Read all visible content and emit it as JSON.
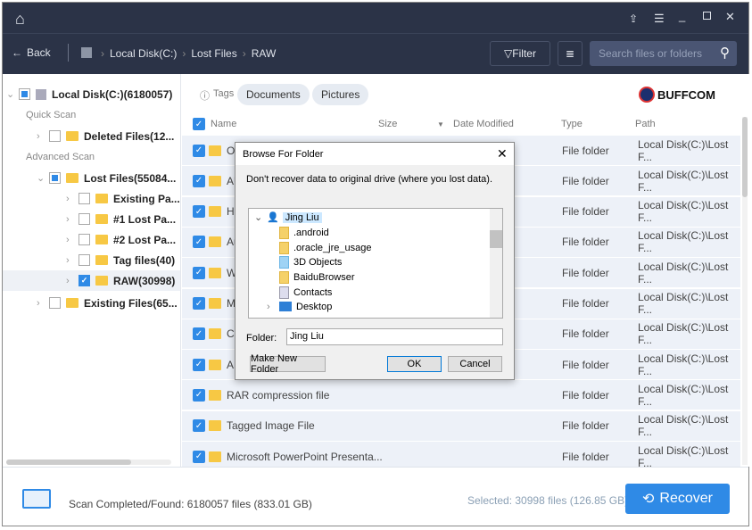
{
  "titlebar": {
    "icons": [
      "home-icon",
      "share-icon",
      "menu-icon",
      "minimize-icon",
      "maximize-icon",
      "close-icon"
    ]
  },
  "toolbar": {
    "back": "Back",
    "breadcrumb": [
      "Local Disk(C:)",
      "Lost Files",
      "RAW"
    ],
    "filter": "Filter",
    "search_placeholder": "Search files or folders"
  },
  "sidebar": {
    "root": "Local Disk(C:)(6180057)",
    "quick_scan": "Quick Scan",
    "deleted": "Deleted Files(12...",
    "advanced_scan": "Advanced Scan",
    "lost": "Lost Files(55084...",
    "children": [
      "Existing Pa...",
      "#1 Lost Pa...",
      "#2 Lost Pa...",
      "Tag files(40)",
      "RAW(30998)"
    ],
    "existing": "Existing Files(65..."
  },
  "tags": {
    "label": "Tags",
    "items": [
      "Documents",
      "Pictures"
    ]
  },
  "logo": "BUFFCOM",
  "columns": {
    "name": "Name",
    "size": "Size",
    "date": "Date Modified",
    "type": "Type",
    "path": "Path"
  },
  "rows": [
    {
      "name": "Og",
      "type": "File folder",
      "path": "Local Disk(C:)\\Lost F..."
    },
    {
      "name": "AU",
      "type": "File folder",
      "path": "Local Disk(C:)\\Lost F..."
    },
    {
      "name": "He",
      "type": "File folder",
      "path": "Local Disk(C:)\\Lost F..."
    },
    {
      "name": "Au",
      "type": "File folder",
      "path": "Local Disk(C:)\\Lost F..."
    },
    {
      "name": "W",
      "type": "File folder",
      "path": "Local Disk(C:)\\Lost F..."
    },
    {
      "name": "M",
      "type": "File folder",
      "path": "Local Disk(C:)\\Lost F..."
    },
    {
      "name": "Ch",
      "type": "File folder",
      "path": "Local Disk(C:)\\Lost F..."
    },
    {
      "name": "AN",
      "type": "File folder",
      "path": "Local Disk(C:)\\Lost F..."
    },
    {
      "name": "RAR compression file",
      "type": "File folder",
      "path": "Local Disk(C:)\\Lost F..."
    },
    {
      "name": "Tagged Image File",
      "type": "File folder",
      "path": "Local Disk(C:)\\Lost F..."
    },
    {
      "name": "Microsoft PowerPoint Presenta...",
      "type": "File folder",
      "path": "Local Disk(C:)\\Lost F..."
    }
  ],
  "footer": {
    "status": "Scan Completed/Found: 6180057 files (833.01 GB)",
    "selected": "Selected: 30998 files (126.85 GB)",
    "recover": "Recover"
  },
  "dialog": {
    "title": "Browse For Folder",
    "message": "Don't recover data to original drive (where you lost data).",
    "tree": [
      "Jing Liu",
      ".android",
      ".oracle_jre_usage",
      "3D Objects",
      "BaiduBrowser",
      "Contacts",
      "Desktop"
    ],
    "folder_label": "Folder:",
    "folder_value": "Jing Liu",
    "make_new": "Make New Folder",
    "ok": "OK",
    "cancel": "Cancel"
  },
  "colors": {
    "header": "#2b3347",
    "accent": "#2f8ae6",
    "folder": "#f7c844"
  }
}
